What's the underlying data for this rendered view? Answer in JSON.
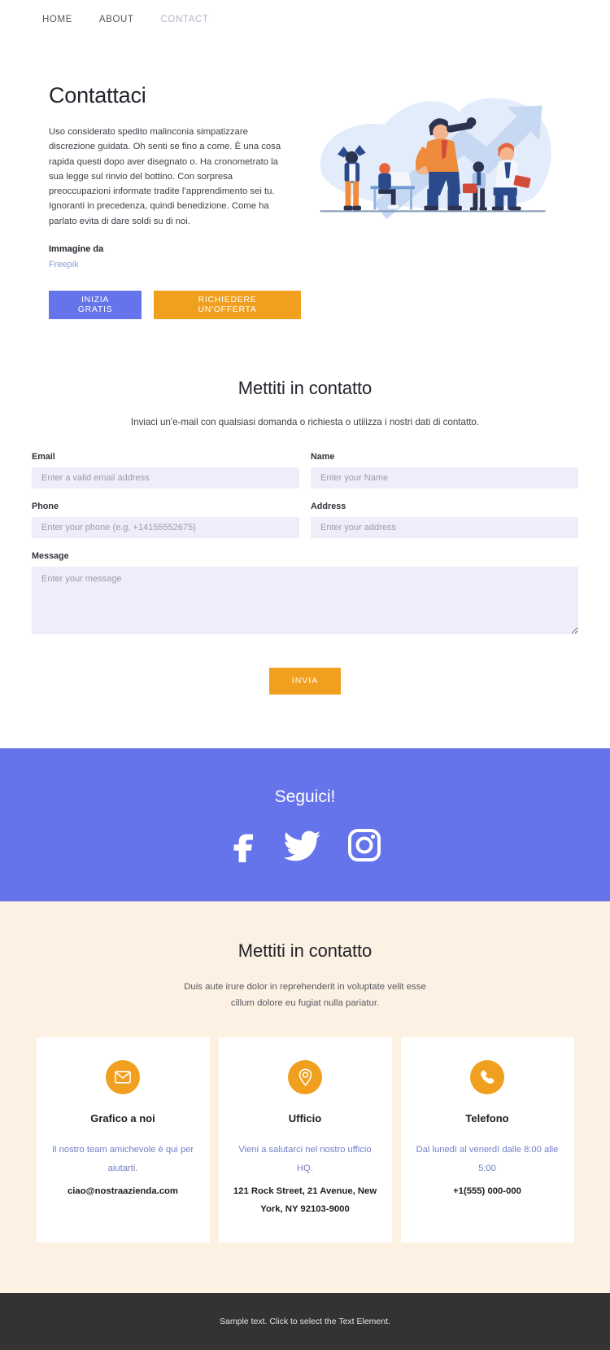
{
  "nav": {
    "items": [
      {
        "label": "HOME",
        "active": true
      },
      {
        "label": "ABOUT",
        "active": true
      },
      {
        "label": "CONTACT",
        "active": false
      }
    ]
  },
  "hero": {
    "title": "Contattaci",
    "body": "Uso considerato spedito malinconia simpatizzare discrezione guidata. Oh senti se fino a come. È una cosa rapida questi dopo aver disegnato o. Ha cronometrato la sua legge sul rinvio del bottino. Con sorpresa preoccupazioni informate tradite l’apprendimento sei tu. Ignoranti in precedenza, quindi benedizione. Come ha parlato evita di dare soldi su di noi.",
    "credit_label": "Immagine da",
    "credit_link": "Freepik",
    "primary_button": "INIZIA GRATIS",
    "secondary_button": "RICHIEDERE UN'OFFERTA",
    "illustration_name": "business-team-growth-illustration"
  },
  "form": {
    "title": "Mettiti in contatto",
    "subtitle": "Inviaci un'e-mail con qualsiasi domanda o richiesta o utilizza i nostri dati di contatto.",
    "fields": [
      {
        "label": "Email",
        "placeholder": "Enter a valid email address",
        "value": "",
        "name": "email-field",
        "type": "input"
      },
      {
        "label": "Name",
        "placeholder": "Enter your Name",
        "value": "",
        "name": "name-field",
        "type": "input"
      },
      {
        "label": "Phone",
        "placeholder": "Enter your phone (e.g. +14155552675)",
        "value": "",
        "name": "phone-field",
        "type": "input"
      },
      {
        "label": "Address",
        "placeholder": "Enter your address",
        "value": "",
        "name": "address-field",
        "type": "input"
      },
      {
        "label": "Message",
        "placeholder": "Enter your message",
        "value": "",
        "name": "message-field",
        "type": "textarea"
      }
    ],
    "submit_label": "INVIA"
  },
  "social": {
    "title": "Seguici!",
    "icons": [
      {
        "name": "facebook-icon"
      },
      {
        "name": "twitter-icon"
      },
      {
        "name": "instagram-icon"
      }
    ]
  },
  "contact": {
    "title": "Mettiti in contatto",
    "subtitle_line1": "Duis aute irure dolor in reprehenderit in voluptate velit esse",
    "subtitle_line2": "cillum dolore eu fugiat nulla pariatur.",
    "cards": [
      {
        "icon": "envelope-icon",
        "title": "Grafico a noi",
        "desc": "Il nostro team amichevole è qui per aiutarti.",
        "value": "ciao@nostraazienda.com"
      },
      {
        "icon": "location-pin-icon",
        "title": "Ufficio",
        "desc": "Vieni a salutarci nel nostro ufficio HQ.",
        "value": "121 Rock Street, 21 Avenue, New York, NY 92103-9000"
      },
      {
        "icon": "phone-icon",
        "title": "Telefono",
        "desc": "Dal lunedì al venerdì dalle 8:00 alle 5:00",
        "value": "+1(555) 000-000"
      }
    ]
  },
  "footer": {
    "text": "Sample text. Click to select the Text Element."
  },
  "colors": {
    "accent_purple": "#6674EC",
    "accent_orange": "#F0A01E",
    "beige_bg": "#FDF1E3",
    "input_bg": "#EEEEFA",
    "footer_bg": "#333333",
    "link_blue": "#717EC9"
  }
}
